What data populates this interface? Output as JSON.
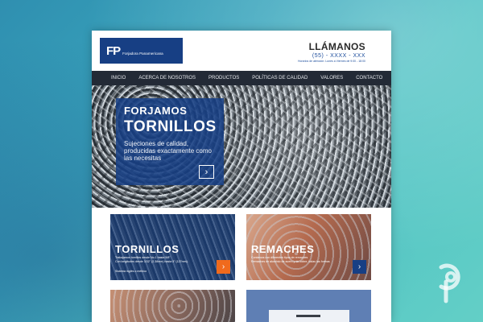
{
  "header": {
    "logo_mark": "FP",
    "logo_text": "Forjadora Panamericana",
    "call_title": "LLÁMANOS",
    "call_phone": "(55) - XXXX - XXX",
    "call_hours": "Horarios de atención: Lunes a Viernes de 9:00 - 18:00"
  },
  "nav": {
    "items": [
      "INICIO",
      "ACERCA DE NOSOTROS",
      "PRODUCTOS",
      "POLÍTICAS DE CALIDAD",
      "VALORES",
      "CONTACTO"
    ]
  },
  "hero": {
    "pre_title": "FORJAMOS",
    "title": "TORNILLOS",
    "subtitle": "Sujeciones de calidad, producidas exactamente como las necesitas",
    "arrow": "›"
  },
  "cards": {
    "tornillos": {
      "title": "TORNILLOS",
      "line1": "Trabajamos tornillos desde No.1 hasta 5/8\"",
      "line2": "Con longitudes desde 3/32\" (2.38mm) hasta 5\" (127mm).",
      "link": "Sistema inglés o métrico",
      "arrow": "›"
    },
    "remaches": {
      "title": "REMACHES",
      "line1": "Contamos con diferentes tipos de remaches",
      "line2": "Remaches de aluminio de acero y de cobre, todas las formas",
      "arrow": "›"
    }
  },
  "colors": {
    "brand_blue": "#173f84",
    "nav_dark": "#232a36",
    "accent_orange": "#f06a1d",
    "background_teal": "#3aa6bd"
  }
}
